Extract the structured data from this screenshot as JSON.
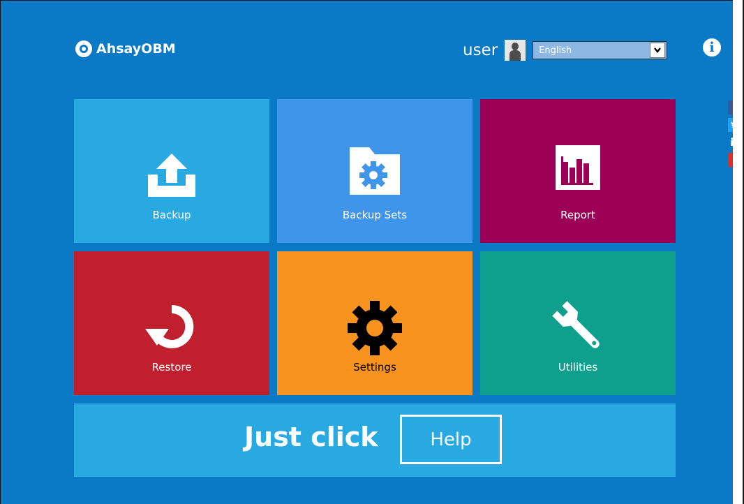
{
  "app": {
    "logo_text": "AhsayOBM"
  },
  "header": {
    "username": "user",
    "language": {
      "selected": "English"
    }
  },
  "tiles": [
    {
      "label": "Backup",
      "color": "#29a9e1",
      "icon": "upload-icon"
    },
    {
      "label": "Backup Sets",
      "color": "#3f95ea",
      "icon": "folder-gear-icon"
    },
    {
      "label": "Report",
      "color": "#9b0056",
      "icon": "bar-chart-icon"
    },
    {
      "label": "Restore",
      "color": "#c01f2d",
      "icon": "restore-icon"
    },
    {
      "label": "Settings",
      "color": "#f7931e",
      "icon": "gear-icon"
    },
    {
      "label": "Utilities",
      "color": "#0fa08d",
      "icon": "wrench-icon"
    }
  ],
  "help_bar": {
    "prefix": "Just click",
    "button_label": "Help",
    "color": "#29a9e1"
  },
  "social": [
    "facebook-icon",
    "twitter-icon",
    "linkedin-icon",
    "youtube-icon"
  ],
  "colors": {
    "background": "#0a7ac6"
  }
}
